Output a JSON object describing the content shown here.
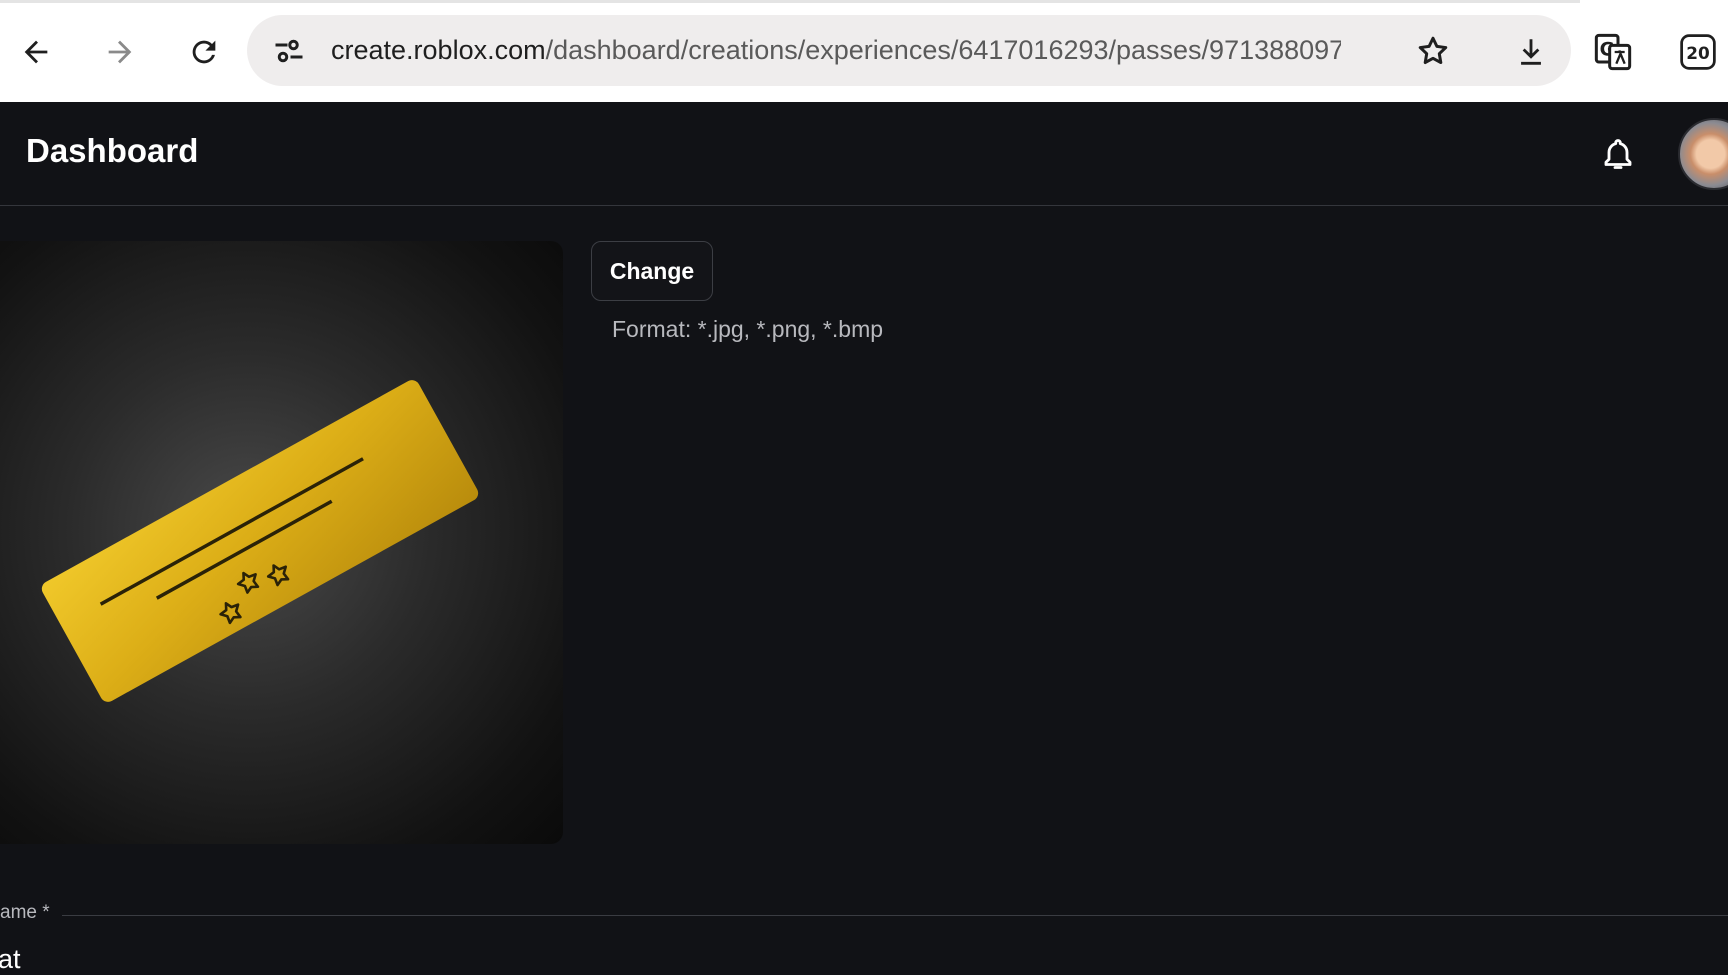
{
  "browser": {
    "url_host": "create.roblox.com",
    "url_path": "/dashboard/creations/experiences/6417016293/passes/971388097/",
    "tab_count": "20"
  },
  "header": {
    "title": "Dashboard"
  },
  "upload": {
    "change_label": "Change",
    "format_text": "Format: *.jpg, *.png, *.bmp"
  },
  "form": {
    "name_label": "ame *",
    "name_value": "at"
  },
  "colors": {
    "page_bg": "#111216",
    "ticket_gold": "#d9ad1a",
    "text_primary": "#ffffff",
    "text_secondary": "#b8b9be"
  }
}
